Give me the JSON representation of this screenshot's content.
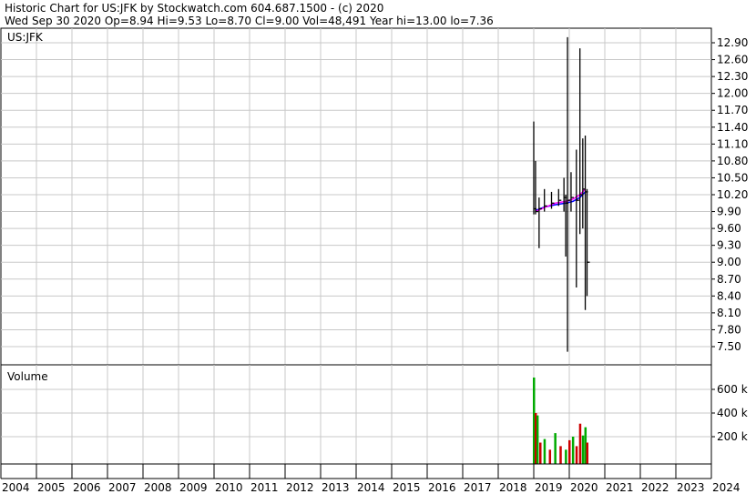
{
  "header": {
    "line1": "Historic Chart for US:JFK by Stockwatch.com 604.687.1500 - (c) 2020",
    "line2": "Wed Sep 30 2020  Op=8.94  Hi=9.53  Lo=8.70  Cl=9.00  Vol=48,491  Year hi=13.00  lo=7.36"
  },
  "chart_data": [
    {
      "type": "line",
      "title": "US:JFK",
      "ylabel": "",
      "ylim": [
        7.2,
        13.1
      ],
      "yticks": [
        "12.90",
        "12.60",
        "12.30",
        "12.00",
        "11.70",
        "11.40",
        "11.10",
        "10.80",
        "10.50",
        "10.20",
        "9.90",
        "9.60",
        "9.30",
        "9.00",
        "8.70",
        "8.40",
        "8.10",
        "7.80",
        "7.50"
      ],
      "grid": true,
      "price_bars": [
        {
          "x": 2019.0,
          "low": 9.85,
          "high": 11.5,
          "close": 9.95
        },
        {
          "x": 2019.05,
          "low": 9.85,
          "high": 10.8,
          "close": 9.9
        },
        {
          "x": 2019.15,
          "low": 9.25,
          "high": 10.15,
          "close": 9.95
        },
        {
          "x": 2019.3,
          "low": 9.9,
          "high": 10.3,
          "close": 10.0
        },
        {
          "x": 2019.5,
          "low": 9.95,
          "high": 10.25,
          "close": 10.05
        },
        {
          "x": 2019.7,
          "low": 10.0,
          "high": 10.3,
          "close": 10.1
        },
        {
          "x": 2019.85,
          "low": 9.9,
          "high": 10.5,
          "close": 10.15
        },
        {
          "x": 2019.9,
          "low": 9.1,
          "high": 10.2,
          "close": 10.05
        },
        {
          "x": 2019.95,
          "low": 7.41,
          "high": 13.0,
          "close": 10.1
        },
        {
          "x": 2020.05,
          "low": 9.9,
          "high": 10.6,
          "close": 10.15
        },
        {
          "x": 2020.2,
          "low": 8.55,
          "high": 11.0,
          "close": 10.1
        },
        {
          "x": 2020.3,
          "low": 9.5,
          "high": 12.8,
          "close": 10.2
        },
        {
          "x": 2020.38,
          "low": 9.6,
          "high": 11.2,
          "close": 10.3
        },
        {
          "x": 2020.45,
          "low": 8.15,
          "high": 11.25,
          "close": 10.25
        },
        {
          "x": 2020.5,
          "low": 8.4,
          "high": 10.3,
          "close": 9.0
        }
      ],
      "moving_averages": [
        {
          "name": "",
          "color": "#0000ff",
          "points": [
            [
              2019.05,
              9.92
            ],
            [
              2019.3,
              9.98
            ],
            [
              2019.6,
              10.02
            ],
            [
              2019.9,
              10.05
            ],
            [
              2020.1,
              10.08
            ],
            [
              2020.3,
              10.15
            ],
            [
              2020.45,
              10.25
            ]
          ]
        },
        {
          "name": "",
          "color": "#ff00ff",
          "points": [
            [
              2019.05,
              9.9
            ],
            [
              2019.3,
              9.97
            ],
            [
              2019.6,
              10.05
            ],
            [
              2019.9,
              10.08
            ],
            [
              2020.1,
              10.12
            ],
            [
              2020.3,
              10.2
            ],
            [
              2020.45,
              10.3
            ]
          ]
        }
      ]
    },
    {
      "type": "bar",
      "title": "Volume",
      "ylim": [
        0,
        700
      ],
      "yticks": [
        "600 k",
        "400 k",
        "200 k"
      ],
      "grid": true,
      "bars": [
        {
          "x": 2019.0,
          "value": 700,
          "color": "#00aa00"
        },
        {
          "x": 2019.05,
          "value": 400,
          "color": "#cc0000"
        },
        {
          "x": 2019.1,
          "value": 380,
          "color": "#00aa00"
        },
        {
          "x": 2019.18,
          "value": 150,
          "color": "#cc0000"
        },
        {
          "x": 2019.3,
          "value": 180,
          "color": "#00aa00"
        },
        {
          "x": 2019.45,
          "value": 90,
          "color": "#cc0000"
        },
        {
          "x": 2019.6,
          "value": 230,
          "color": "#00aa00"
        },
        {
          "x": 2019.75,
          "value": 120,
          "color": "#cc0000"
        },
        {
          "x": 2019.9,
          "value": 90,
          "color": "#00aa00"
        },
        {
          "x": 2020.0,
          "value": 170,
          "color": "#cc0000"
        },
        {
          "x": 2020.1,
          "value": 200,
          "color": "#00aa00"
        },
        {
          "x": 2020.2,
          "value": 120,
          "color": "#cc0000"
        },
        {
          "x": 2020.3,
          "value": 310,
          "color": "#cc0000"
        },
        {
          "x": 2020.38,
          "value": 210,
          "color": "#00aa00"
        },
        {
          "x": 2020.45,
          "value": 280,
          "color": "#00aa00"
        },
        {
          "x": 2020.5,
          "value": 150,
          "color": "#cc0000"
        }
      ]
    }
  ],
  "x_axis": {
    "type": "year",
    "xlim": [
      2004,
      2024
    ],
    "tick_labels": [
      "2004",
      "2005",
      "2006",
      "2007",
      "2008",
      "2009",
      "2010",
      "2011",
      "2012",
      "2013",
      "2014",
      "2015",
      "2016",
      "2017",
      "2018",
      "2019",
      "2020",
      "2021",
      "2022",
      "2023",
      "2024"
    ]
  }
}
